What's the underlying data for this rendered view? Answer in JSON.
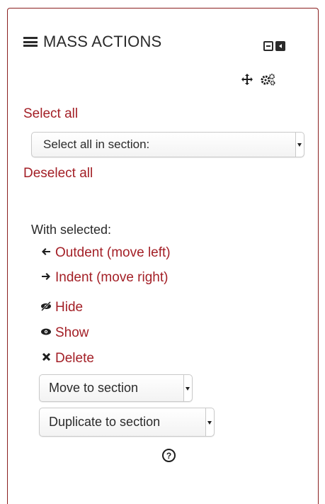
{
  "block": {
    "title": "MASS ACTIONS"
  },
  "select_all": {
    "label": "Select all",
    "dropdown_value": "Select all in section:"
  },
  "deselect_all": {
    "label": "Deselect all"
  },
  "with_selected": {
    "label": "With selected:"
  },
  "actions": [
    {
      "label": "Outdent (move left)",
      "icon": "arrow-left-icon"
    },
    {
      "label": "Indent (move right)",
      "icon": "arrow-right-icon"
    },
    {
      "label": "Hide",
      "icon": "eye-slash-icon"
    },
    {
      "label": "Show",
      "icon": "eye-icon"
    },
    {
      "label": "Delete",
      "icon": "delete-x-icon"
    }
  ],
  "move_select": {
    "value": "Move to section"
  },
  "duplicate_select": {
    "value": "Duplicate to section"
  },
  "colors": {
    "accent": "#a31f26",
    "border": "#8a1f1f",
    "text": "#2a2a2a"
  }
}
